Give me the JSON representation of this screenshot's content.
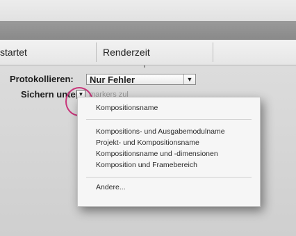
{
  "table_header": {
    "col1_label": "startet",
    "col2_label": "Renderzeit"
  },
  "log": {
    "label": "Protokollieren:",
    "dropdown_value": "Nur Fehler"
  },
  "save_as": {
    "label": "Sichern unter:",
    "faint_text": "markers zul"
  },
  "menu": {
    "items": [
      "Kompositionsname",
      "Kompositions- und Ausgabemodulname",
      "Projekt- und Kompositionsname",
      "Kompositionsname und -dimensionen",
      "Komposition und Framebereich",
      "Andere..."
    ]
  },
  "icons": {
    "dropdown_arrow": "▼"
  }
}
